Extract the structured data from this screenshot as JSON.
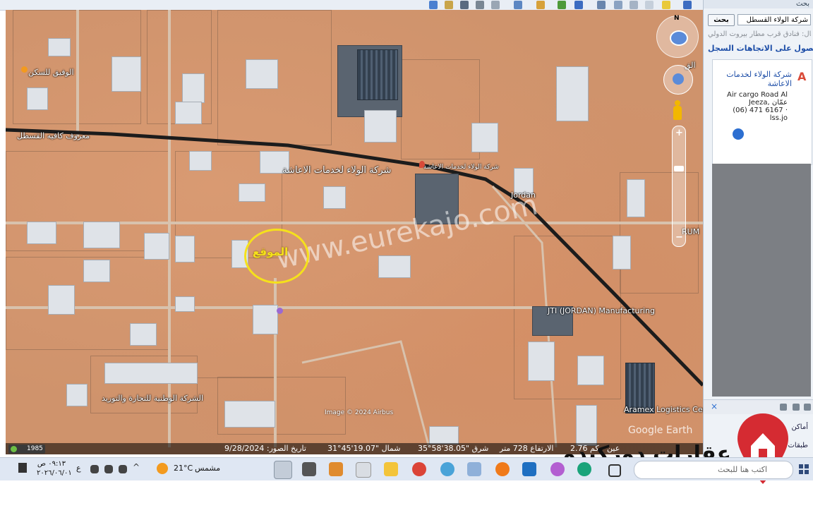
{
  "map": {
    "labels": {
      "site": "الموقع",
      "company_main": "شركة الولاء لخدمات الاعاشة",
      "company_small": "شركة الولاء لخدمات الاعاشة",
      "cafe": "معروف كافيه القسطل",
      "jordan_road": "Jordan",
      "rum": "RUM",
      "jti": "JTI (JORDAN) Manufacturing",
      "national_company": "الشركة الوطنية للتجارة والتوريد",
      "aramex": "Aramex Logistics Center",
      "top_right_fragment": "الق",
      "top_left_place": "الوفيق للسكن"
    },
    "watermark": "www.eurekajo.com",
    "image_credit": "Image © 2024 Airbus",
    "brand": "Google Earth",
    "status": {
      "year": "1985",
      "imagery_date": "تاريخ الصور: 9/28/2024",
      "lat": "31°45'19.07\" شمال",
      "lon": "35°58'38.05\" شرق",
      "elevation": "الارتفاع 728 متر",
      "eye_alt": "2.76 كم",
      "eye_prefix": "عين"
    },
    "compass_n": "N"
  },
  "panel": {
    "header": "بحث",
    "search_value": "شركة الولاء القسطل",
    "search_button": "بحث",
    "hint": "مثال: فنادق قرب مطار بيروت الدولي",
    "directions": "الحصول على الاتجاهات السجل",
    "result": {
      "marker": "A",
      "name": "شركة الولاء لخدمات الاعاشة",
      "address_line1": "Air cargo Road Al",
      "address_line2": "Jeeza, عمّان",
      "phone": "(06) 471 6167 ·",
      "website": "lss.jo"
    },
    "close": "×",
    "places": "أماكن",
    "layers": "طبقات"
  },
  "taskbar": {
    "time": "٠٩:١٣ ص",
    "date": "٢٠٢٦/٠٦/٠١",
    "lang": "ع",
    "temp": "21°C",
    "weather": "مشمس",
    "search_placeholder": "اكتب هنا للبحث",
    "chevron": "^"
  },
  "brand": {
    "text": "عقارات دوركيدو"
  },
  "colors": {
    "map_base": "#cf936c",
    "site_circle": "#f5e11b",
    "link": "#1f4fa8",
    "marker": "#d94a38",
    "road": "#1c1c1c",
    "taskbar": "#dfe7f3",
    "logo_red": "#d52b32"
  }
}
